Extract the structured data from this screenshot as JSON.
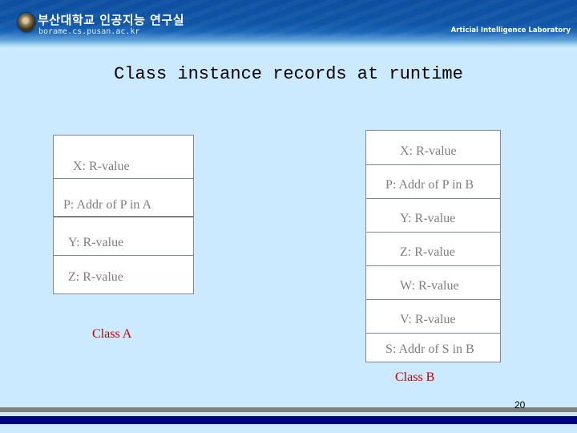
{
  "header": {
    "korean_title": "부산대학교 인공지능 연구실",
    "site_url": "borame.cs.pusan.ac.kr",
    "lab_name": "Articial Intelligence Laboratory",
    "emblem_icon": "university-seal-icon"
  },
  "slide": {
    "title": "Class instance records at runtime",
    "page_number": "20"
  },
  "class_a": {
    "label": "Class A",
    "rows": [
      "X: R-value",
      "P: Addr of  P in A",
      "Y: R-value",
      "Z: R-value"
    ]
  },
  "class_b": {
    "label": "Class B",
    "rows": [
      "X: R-value",
      "P: Addr of P in B",
      "Y: R-value",
      "Z: R-value",
      "W: R-value",
      "V: R-value",
      "S: Addr of S in B"
    ]
  },
  "colors": {
    "background": "#cceaff",
    "class_label": "#c00000",
    "cell_text": "#7f7f7f",
    "footer_gray": "#808080",
    "footer_navy": "#000080"
  }
}
